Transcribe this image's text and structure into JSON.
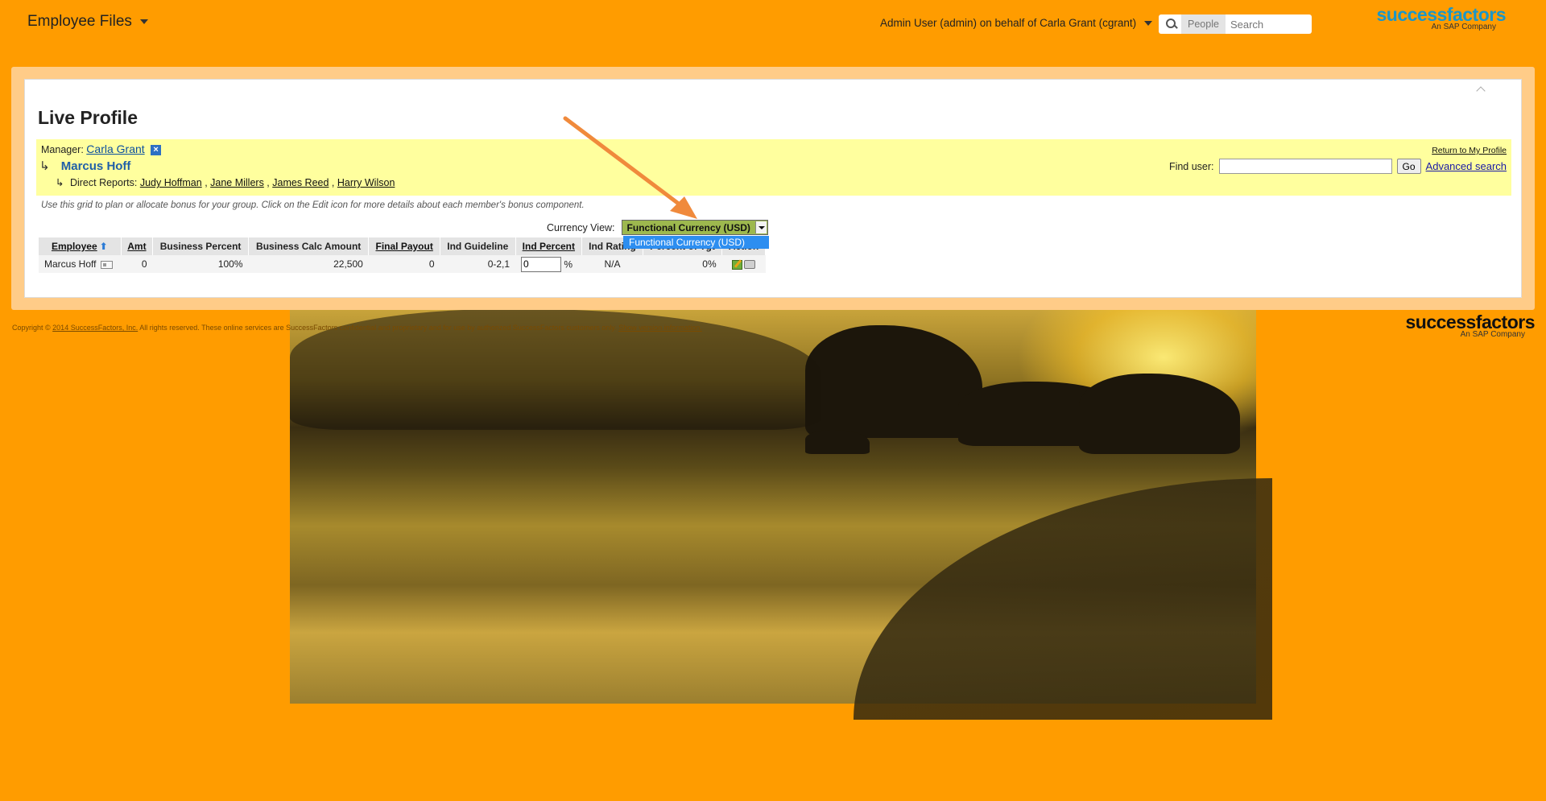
{
  "header": {
    "module_menu": "Employee Files",
    "proxy_user": "Admin User (admin) on behalf of Carla Grant (cgrant)",
    "search_scope": "People",
    "search_placeholder": "Search",
    "logo_text": "successfactors",
    "logo_tagline": "An SAP Company"
  },
  "page": {
    "title": "Live Profile"
  },
  "org": {
    "manager_label": "Manager:",
    "manager_name": "Carla Grant",
    "self_name": "Marcus Hoff",
    "direct_reports_label": "Direct Reports:",
    "direct_reports": [
      "Judy Hoffman",
      "Jane Millers",
      "James Reed",
      "Harry Wilson"
    ],
    "return_link": "Return to My Profile",
    "find_user_label": "Find user:",
    "find_user_value": "",
    "go_button": "Go",
    "advanced_search": "Advanced search"
  },
  "hint": "Use this grid to plan or allocate bonus for your group. Click on the Edit icon for more details about each member's bonus component.",
  "currency": {
    "label": "Currency View:",
    "selected": "Functional Currency (USD)",
    "options": [
      "Functional Currency (USD)"
    ]
  },
  "grid": {
    "columns": [
      "Employee",
      "Amt",
      "Business Percent",
      "Business Calc Amount",
      "Final Payout",
      "Ind Guideline",
      "Ind Percent",
      "Ind Rating",
      "Percent of Tgt",
      "Action"
    ],
    "rows": [
      {
        "employee": "Marcus Hoff",
        "amt": "0",
        "business_percent": "100%",
        "business_calc_amount": "22,500",
        "final_payout": "0",
        "ind_guideline": "0-2,1",
        "ind_percent": "0",
        "ind_percent_unit": "%",
        "ind_rating": "N/A",
        "percent_of_tgt": "0%"
      }
    ]
  },
  "footer": {
    "copyright_pre": "Copyright ©",
    "copyright_link": "2014 SuccessFactors, Inc.",
    "copyright_text": "All rights reserved. These online services are SuccessFactors confidential and proprietary and for use by authorized SuccessFactors customers only.",
    "info_link": "Show version information."
  },
  "colors": {
    "background": "#ff9c00",
    "band": "#ffff9e",
    "selection": "#2d8ef0",
    "annotation_arrow": "#f08a3c"
  },
  "icons": [
    "search-icon",
    "chevron-down-icon",
    "close-icon",
    "sort-up-icon",
    "profile-card-icon",
    "edit-icon",
    "print-icon",
    "collapse-icon"
  ]
}
